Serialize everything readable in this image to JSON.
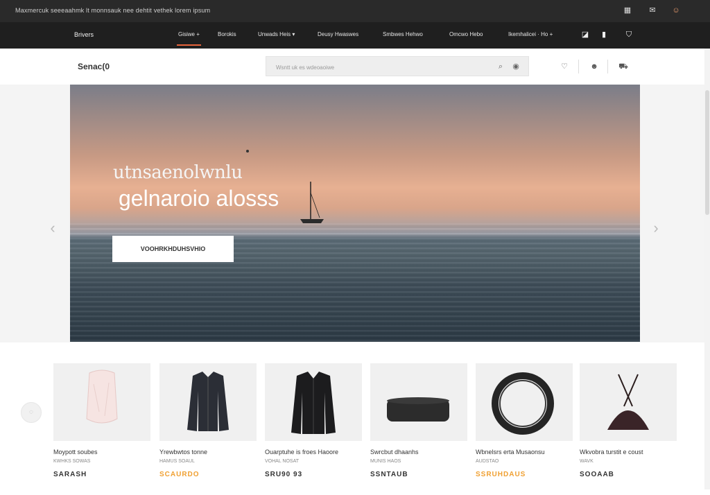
{
  "topbar": {
    "announcement": "Maxmercuk seeeaahmk lt monnsauk nee dehtit vethek lorem ipsum",
    "icons": [
      "heart-icon",
      "mail-icon",
      "user-icon"
    ]
  },
  "navbar": {
    "brand": "Brivers",
    "items": [
      {
        "label": "Gisiwe +",
        "active": true
      },
      {
        "label": "Borokis",
        "active": false
      },
      {
        "label": "Unwads Heis ▾",
        "active": false
      },
      {
        "label": "Deusy Hwaswes",
        "active": false
      },
      {
        "label": "Smbwes Hehwo",
        "active": false
      },
      {
        "label": "Omcwo Hebo",
        "active": false
      },
      {
        "label": "Ikemhalicei · Ho +",
        "active": false
      }
    ],
    "icons": [
      "bag-icon",
      "bookmark-icon",
      "cart-icon"
    ]
  },
  "header": {
    "logo": "Senac(0",
    "search_placeholder": "Wsntt uk es wdeoaoiwe",
    "icons": [
      "wishlist-icon",
      "account-icon",
      "cart-icon"
    ]
  },
  "hero": {
    "headline_small": "utnsaenolwnlu",
    "headline": "gelnaroio alosss",
    "cta_label": "VOOHRKHDUHSVHIO",
    "colors": {
      "sky_top": "#7b7d88",
      "sunset": "#e7b092",
      "sea": "#2c3a45"
    }
  },
  "products": [
    {
      "name": "Moypott soubes",
      "sub": "KWHKS SOWAS",
      "price": "SARASH",
      "price_color": "dark",
      "image": "sheer-top"
    },
    {
      "name": "Yrewbwtos tonne",
      "sub": "HAMUS SOAUL",
      "price": "SCAURDO",
      "price_color": "orange",
      "image": "black-jacket"
    },
    {
      "name": "Ouarptuhe is froes Haoore",
      "sub": "VOHAL NOSAT",
      "price": "SRU90 93",
      "price_color": "dark",
      "image": "dark-jacket"
    },
    {
      "name": "Swrcbut dhaanhs",
      "sub": "MUNIS HAOS",
      "price": "SSNTAUB",
      "price_color": "dark",
      "image": "belt"
    },
    {
      "name": "Wbnelsrs erta Musaonsu",
      "sub": "AUDSTAO",
      "price": "SSRUHDAUS",
      "price_color": "orange",
      "image": "ring"
    },
    {
      "name": "Wkvobra turstit e coust",
      "sub": "WAVK",
      "price": "SOOAAB",
      "price_color": "dark",
      "image": "handbag"
    }
  ]
}
